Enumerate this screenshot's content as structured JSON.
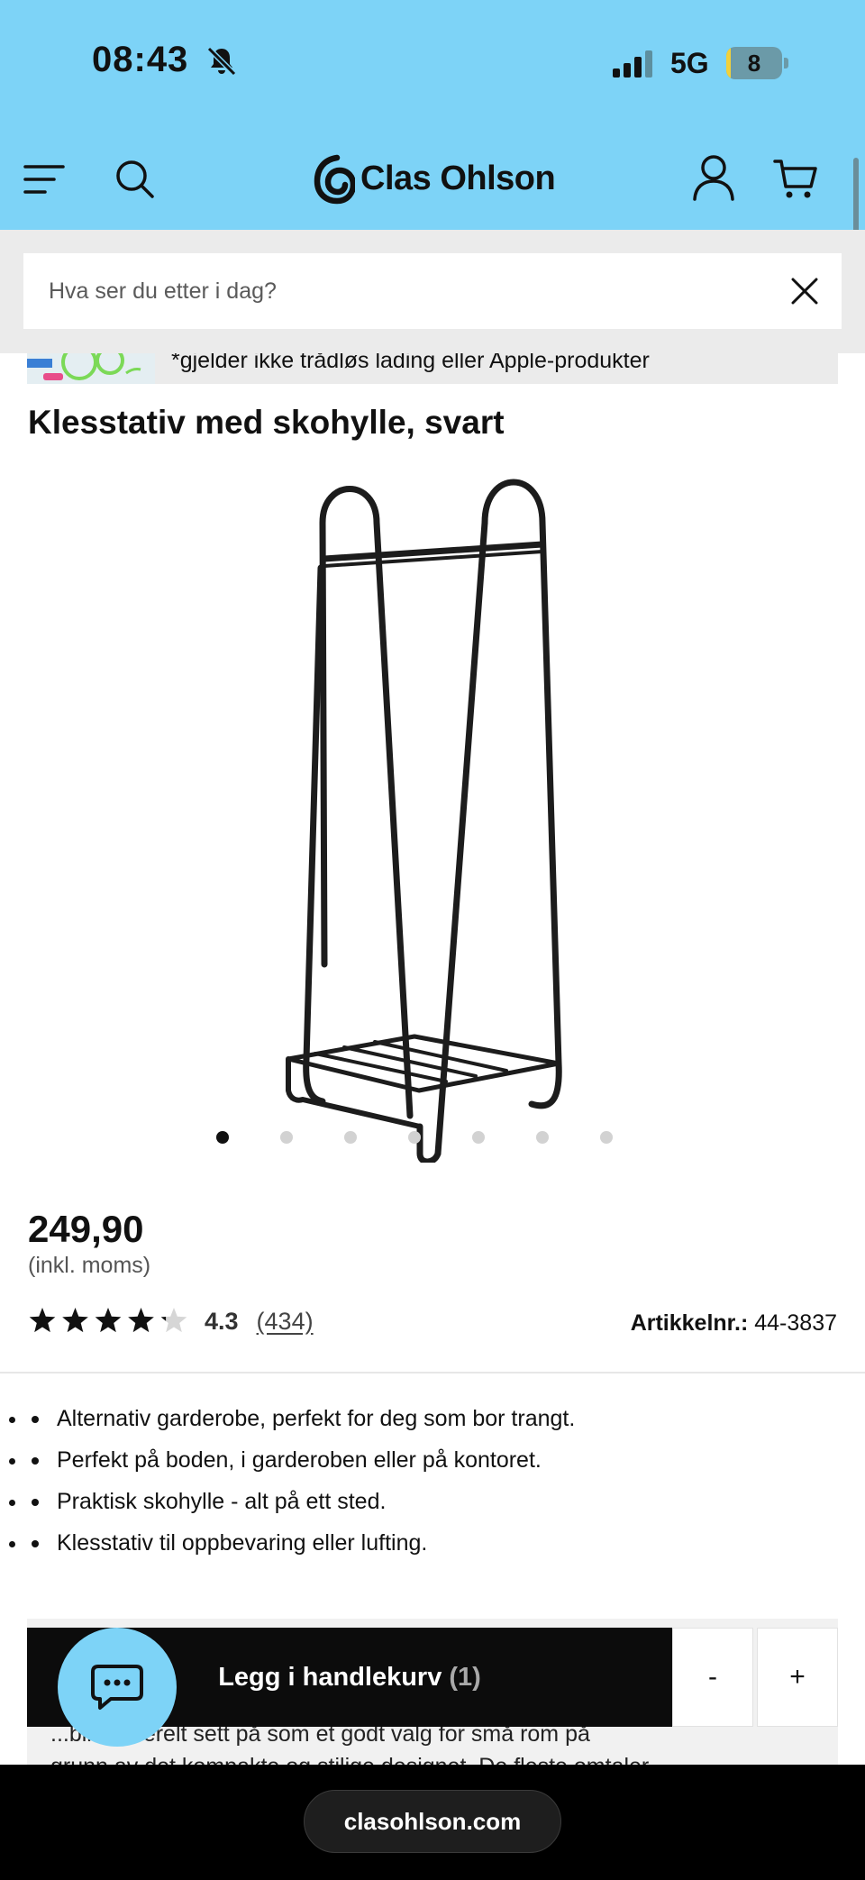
{
  "status_bar": {
    "time": "08:43",
    "network": "5G",
    "battery_level": "8",
    "battery_fraction": 0.08
  },
  "header": {
    "brand": "Clas Ohlson",
    "icons": [
      "menu-icon",
      "search-icon",
      "user-icon",
      "cart-icon"
    ]
  },
  "search": {
    "placeholder": "Hva ser du etter i dag?"
  },
  "promo": {
    "text": "*gjelder ikke trådløs lading eller Apple-produkter"
  },
  "product": {
    "title": "Klesstativ med skohylle, svart",
    "price": "249,90",
    "price_note": "(inkl. moms)",
    "rating_value": "4.3",
    "rating_fraction": 0.86,
    "rating_count": "(434)",
    "article_label": "Artikkelnr.:",
    "article_number": "44-3837",
    "image_count": 7,
    "active_image": 1,
    "bullets": [
      "Alternativ garderobe, perfekt for deg som bor trangt.",
      "Perfekt på boden, i garderoben eller på kontoret.",
      "Praktisk skohylle - alt på ett sted.",
      "Klesstativ til oppbevaring eller lufting."
    ]
  },
  "review_summary": {
    "line1": "...blir generelt sett på som et godt valg for små rom på",
    "line2": "grunn av det kompakte og stilige designet. De fleste omtaler"
  },
  "cta": {
    "label": "Legg i handlekurv",
    "quantity": "(1)",
    "minus": "-",
    "plus": "+"
  },
  "browser": {
    "url": "clasohlson.com"
  },
  "colors": {
    "header_bg": "#7dd3f7",
    "cta_bg": "#0c0c0c"
  }
}
